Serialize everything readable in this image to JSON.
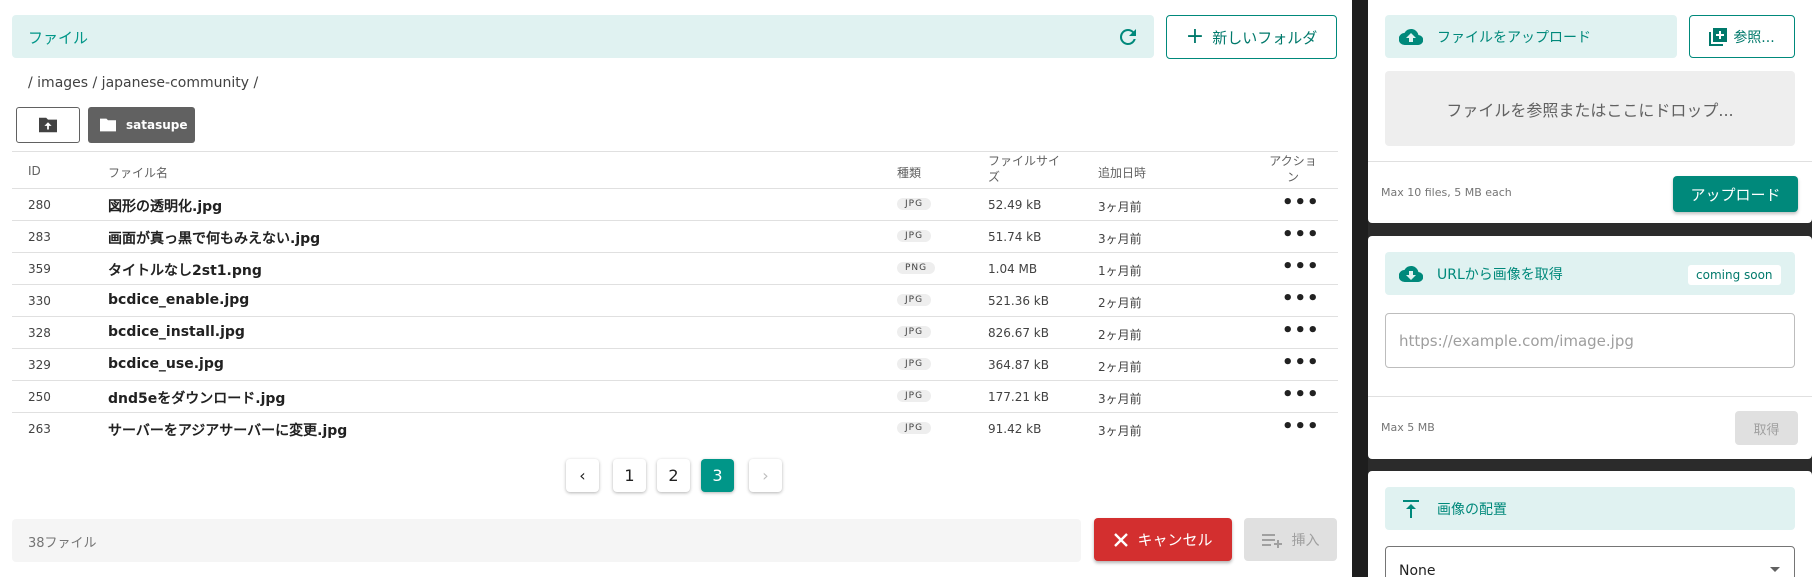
{
  "header": {
    "title": "ファイル",
    "new_folder_label": "新しいフォルダ"
  },
  "breadcrumb": "/ images / japanese-community /",
  "folders": [
    {
      "name": "satasupe"
    }
  ],
  "table": {
    "columns": [
      "ID",
      "ファイル名",
      "種類",
      "ファイルサイズ",
      "追加日時",
      "アクション"
    ],
    "rows": [
      {
        "id": "280",
        "name": "図形の透明化.jpg",
        "type": "JPG",
        "size": "52.49 kB",
        "added": "3ヶ月前"
      },
      {
        "id": "283",
        "name": "画面が真っ黒で何もみえない.jpg",
        "type": "JPG",
        "size": "51.74 kB",
        "added": "3ヶ月前"
      },
      {
        "id": "359",
        "name": "タイトルなし2st1.png",
        "type": "PNG",
        "size": "1.04 MB",
        "added": "1ヶ月前"
      },
      {
        "id": "330",
        "name": "bcdice_enable.jpg",
        "type": "JPG",
        "size": "521.36 kB",
        "added": "2ヶ月前"
      },
      {
        "id": "328",
        "name": "bcdice_install.jpg",
        "type": "JPG",
        "size": "826.67 kB",
        "added": "2ヶ月前"
      },
      {
        "id": "329",
        "name": "bcdice_use.jpg",
        "type": "JPG",
        "size": "364.87 kB",
        "added": "2ヶ月前"
      },
      {
        "id": "250",
        "name": "dnd5eをダウンロード.jpg",
        "type": "JPG",
        "size": "177.21 kB",
        "added": "3ヶ月前"
      },
      {
        "id": "263",
        "name": "サーバーをアジアサーバーに変更.jpg",
        "type": "JPG",
        "size": "91.42 kB",
        "added": "3ヶ月前"
      }
    ],
    "action_glyph": "•••"
  },
  "pagination": {
    "pages": [
      "1",
      "2",
      "3"
    ],
    "current": "3",
    "prev": "‹",
    "next": "›"
  },
  "footer": {
    "file_count": "38ファイル",
    "cancel_label": "キャンセル",
    "insert_label": "挿入"
  },
  "upload_panel": {
    "title": "ファイルをアップロード",
    "browse_label": "参照...",
    "drop_text": "ファイルを参照またはここにドロップ...",
    "limits": "Max 10 files, 5 MB each",
    "upload_label": "アップロード"
  },
  "url_panel": {
    "title": "URLから画像を取得",
    "badge": "coming soon",
    "placeholder": "https://example.com/image.jpg",
    "limits": "Max 5 MB",
    "fetch_label": "取得"
  },
  "placement_panel": {
    "title": "画像の配置",
    "selected": "None"
  },
  "colors": {
    "accent": "#009688",
    "accent_light": "#e0f2f1",
    "danger": "#d32f2f",
    "folder_chip": "#616161"
  }
}
